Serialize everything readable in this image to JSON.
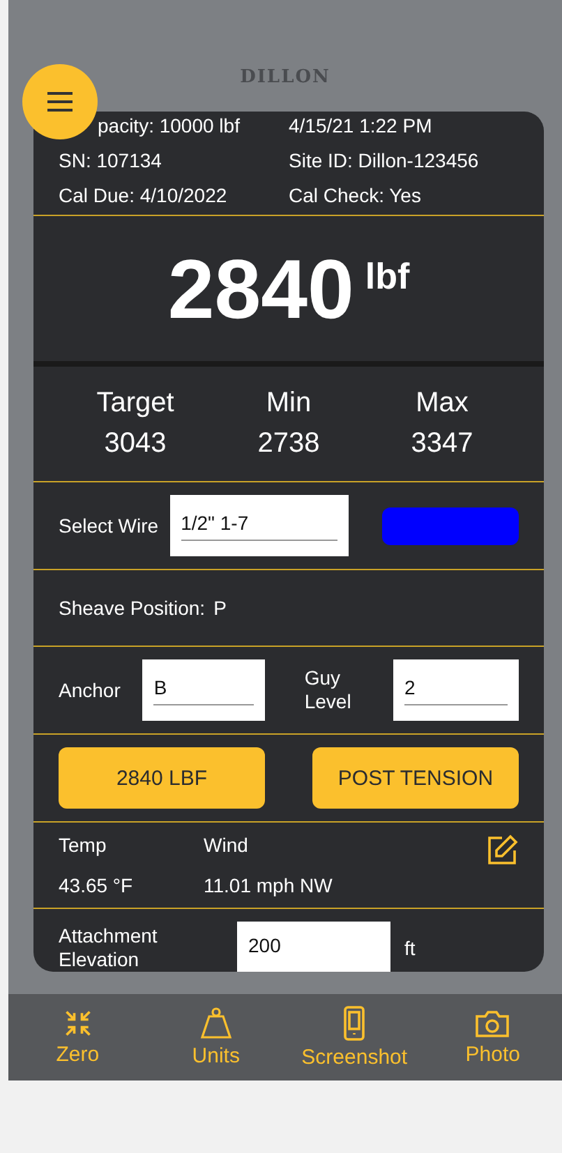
{
  "header": {
    "logo": "DILLON"
  },
  "info": [
    {
      "left": "pacity: 10000 lbf",
      "right": "4/15/21 1:22 PM"
    },
    {
      "left": "SN: 107134",
      "right": "Site ID: Dillon-123456"
    },
    {
      "left": "Cal Due:  4/10/2022",
      "right": "Cal Check: Yes"
    }
  ],
  "reading": {
    "value": "2840",
    "unit": "lbf"
  },
  "limits": [
    {
      "label": "Target",
      "value": "3043"
    },
    {
      "label": "Min",
      "value": "2738"
    },
    {
      "label": "Max",
      "value": "3347"
    }
  ],
  "wire": {
    "label": "Select Wire",
    "value": "1/2\" 1-7",
    "color": "#0000ff"
  },
  "sheave": {
    "label": "Sheave Position:",
    "value": "P"
  },
  "anchor": {
    "label": "Anchor",
    "value": "B"
  },
  "guy_level": {
    "label": "Guy Level",
    "value": "2"
  },
  "buttons": [
    "2840 LBF",
    "POST TENSION"
  ],
  "weather": [
    {
      "label": "Temp",
      "value": "43.65 °F"
    },
    {
      "label": "Wind",
      "value": "11.01 mph  NW"
    }
  ],
  "elevation": {
    "label": "Attachment Elevation",
    "value": "200",
    "unit": "ft"
  },
  "nav": [
    {
      "label": "Zero",
      "kind": "zero"
    },
    {
      "label": "Units",
      "kind": "units"
    },
    {
      "label": "Screenshot",
      "kind": "screenshot"
    },
    {
      "label": "Photo",
      "kind": "photo"
    }
  ]
}
